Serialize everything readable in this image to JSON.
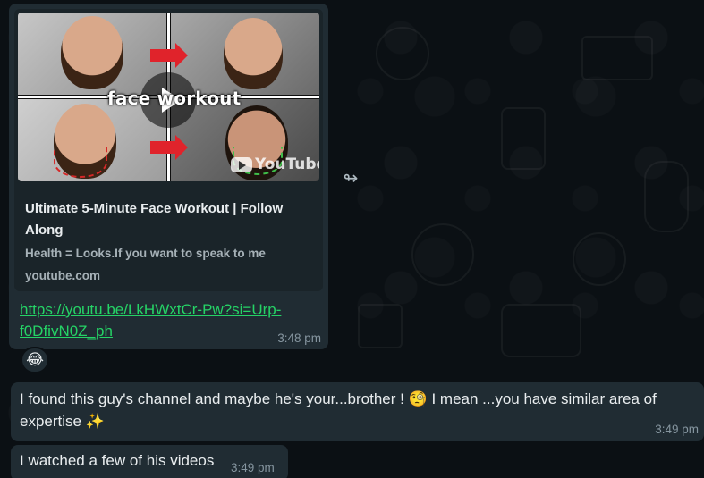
{
  "messages": [
    {
      "type": "link_preview",
      "preview": {
        "thumbnail_caption": "face workout",
        "thumbnail_brand": "YouTube",
        "title": "Ultimate 5-Minute Face Workout | Follow Along",
        "description": "Health = Looks.If you want to speak to me",
        "domain": "youtube.com"
      },
      "link": "https://youtu.be/LkHWxtCr-Pw?si=Urp-f0DfivN0Z_ph",
      "time": "3:48 pm",
      "reaction": "😂"
    },
    {
      "type": "text",
      "text": "I found this guy's channel and maybe he's your...brother ! 🧐 I mean ...you have similar area of expertise ✨",
      "time": "3:49 pm"
    },
    {
      "type": "text",
      "text": "I watched a few of his videos",
      "time": "3:49 pm"
    }
  ],
  "icons": {
    "forward": "forward-icon",
    "play": "play-icon"
  },
  "colors": {
    "background": "#0b1014",
    "bubble": "#202c33",
    "link": "#25d366",
    "text": "#e9edef",
    "meta": "#8696a0"
  }
}
